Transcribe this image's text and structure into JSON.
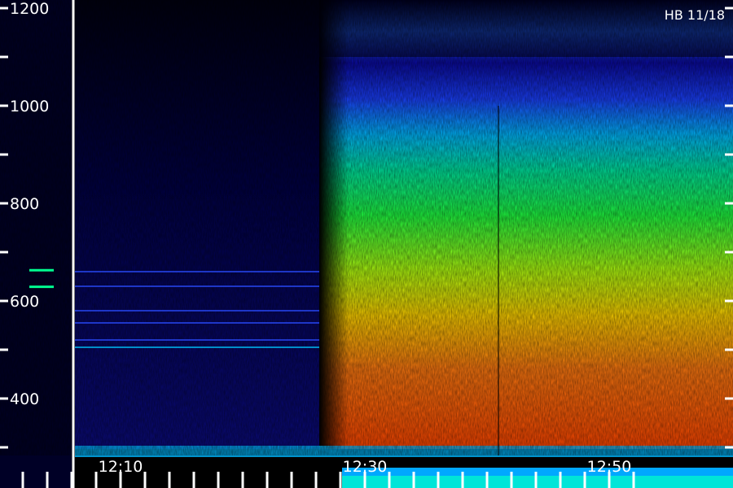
{
  "chart_data": {
    "type": "heatmap",
    "title": "",
    "xlabel": "",
    "ylabel": "",
    "badge": "HB 11/18",
    "y_ticks": [
      400,
      600,
      800,
      1000,
      1200
    ],
    "y_ticks_labels": [
      "400",
      "600",
      "800",
      "1000",
      "1200"
    ],
    "ylim": [
      300,
      1200
    ],
    "x_ticks_labels": [
      "12:10",
      "12:30",
      "12:50"
    ],
    "xlim": [
      "12:02",
      "12:52"
    ],
    "grid": false,
    "colormap": [
      "#000000",
      "#0000ff",
      "#00bfff",
      "#00ff7f",
      "#ffff00",
      "#ff4000"
    ],
    "series": [
      {
        "time": "12:10",
        "spectrum": [
          {
            "f": 400,
            "level": 0.15
          },
          {
            "f": 600,
            "level": 0.12
          },
          {
            "f": 800,
            "level": 0.1
          },
          {
            "f": 1000,
            "level": 0.06
          },
          {
            "f": 1200,
            "level": 0.03
          }
        ]
      },
      {
        "time": "12:20",
        "spectrum": [
          {
            "f": 400,
            "level": 0.18
          },
          {
            "f": 600,
            "level": 0.14
          },
          {
            "f": 800,
            "level": 0.1
          },
          {
            "f": 1000,
            "level": 0.06
          },
          {
            "f": 1200,
            "level": 0.03
          }
        ]
      },
      {
        "time": "12:30",
        "spectrum": [
          {
            "f": 400,
            "level": 0.85
          },
          {
            "f": 600,
            "level": 0.72
          },
          {
            "f": 800,
            "level": 0.55
          },
          {
            "f": 1000,
            "level": 0.35
          },
          {
            "f": 1200,
            "level": 0.15
          }
        ]
      },
      {
        "time": "12:40",
        "spectrum": [
          {
            "f": 400,
            "level": 0.88
          },
          {
            "f": 600,
            "level": 0.75
          },
          {
            "f": 800,
            "level": 0.56
          },
          {
            "f": 1000,
            "level": 0.3
          },
          {
            "f": 1200,
            "level": 0.12
          }
        ]
      },
      {
        "time": "12:50",
        "spectrum": [
          {
            "f": 400,
            "level": 0.92
          },
          {
            "f": 600,
            "level": 0.78
          },
          {
            "f": 800,
            "level": 0.57
          },
          {
            "f": 1000,
            "level": 0.3
          },
          {
            "f": 1200,
            "level": 0.1
          }
        ]
      }
    ]
  }
}
